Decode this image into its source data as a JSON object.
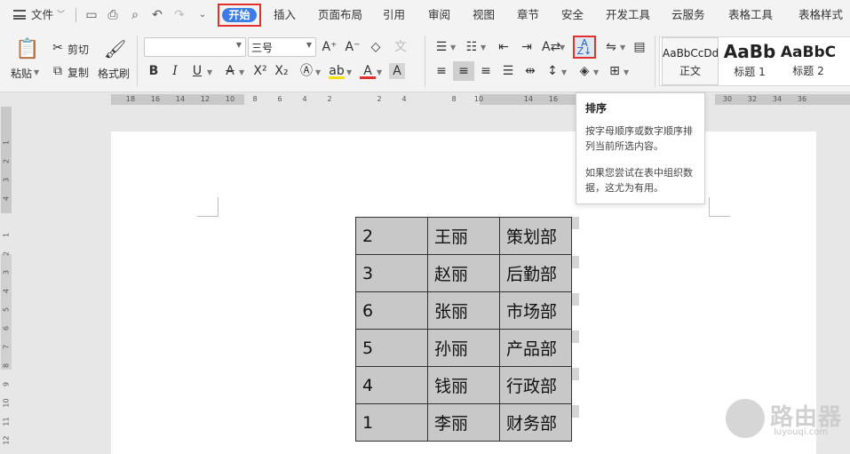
{
  "menu": {
    "file_label": "文件",
    "tabs": [
      "开始",
      "插入",
      "页面布局",
      "引用",
      "审阅",
      "视图",
      "章节",
      "安全",
      "开发工具",
      "云服务",
      "表格工具",
      "表格样式"
    ],
    "active_tab": "开始",
    "active_tab_color": "#3d7ce6",
    "highlight_color": "#e03030"
  },
  "ribbon": {
    "paste_label": "粘贴",
    "cut_label": "剪切",
    "copy_label": "复制",
    "format_painter_label": "格式刷",
    "font_name_value": "",
    "font_size_value": "三号",
    "styles": [
      {
        "preview": "AaBbCcDd",
        "label": "正文"
      },
      {
        "preview": "AaBb",
        "label": "标题 1"
      },
      {
        "preview": "AaBbC",
        "label": "标题 2"
      }
    ]
  },
  "ruler": {
    "h_ticks": [
      "18",
      "16",
      "14",
      "12",
      "10",
      "8",
      "6",
      "4",
      "2",
      "2",
      "4",
      "8",
      "10",
      "14",
      "16",
      "30",
      "32",
      "34",
      "36"
    ],
    "v_ticks": [
      "1",
      "2",
      "3",
      "4",
      "1",
      "2",
      "3",
      "4",
      "5",
      "6",
      "7",
      "8",
      "9",
      "10",
      "11",
      "12"
    ]
  },
  "tooltip": {
    "title": "排序",
    "line1": "按字母顺序或数字顺序排列当前所选内容。",
    "line2": "如果您尝试在表中组织数据，这尤为有用。"
  },
  "table": {
    "rows": [
      [
        "2",
        "王丽",
        "策划部"
      ],
      [
        "3",
        "赵丽",
        "后勤部"
      ],
      [
        "6",
        "张丽",
        "市场部"
      ],
      [
        "5",
        "孙丽",
        "产品部"
      ],
      [
        "4",
        "钱丽",
        "行政部"
      ],
      [
        "1",
        "李丽",
        "财务部"
      ]
    ]
  },
  "watermark": {
    "text": "路由器",
    "sub": "luyouqi.com"
  }
}
